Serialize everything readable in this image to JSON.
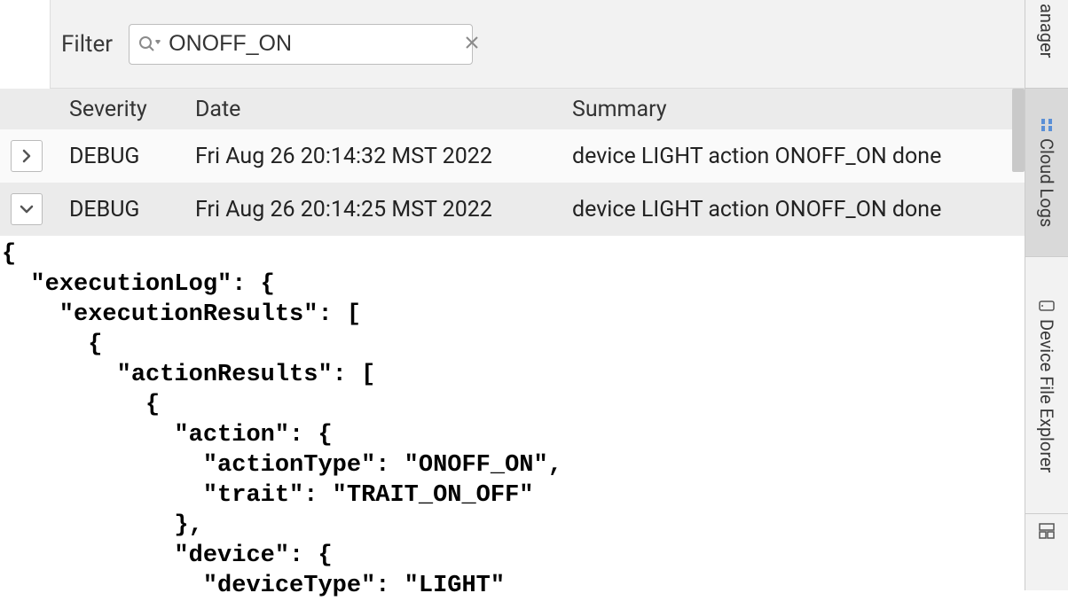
{
  "filter": {
    "label": "Filter",
    "value": "ONOFF_ON",
    "placeholder": ""
  },
  "columns": {
    "severity": "Severity",
    "date": "Date",
    "summary": "Summary"
  },
  "logs": [
    {
      "expanded": false,
      "severity": "DEBUG",
      "date": "Fri Aug 26 20:14:32 MST 2022",
      "summary": "device LIGHT action ONOFF_ON done"
    },
    {
      "expanded": true,
      "severity": "DEBUG",
      "date": "Fri Aug 26 20:14:25 MST 2022",
      "summary": "device LIGHT action ONOFF_ON done"
    }
  ],
  "expanded_json_lines": [
    "{",
    "  \"executionLog\": {",
    "    \"executionResults\": [",
    "      {",
    "        \"actionResults\": [",
    "          {",
    "            \"action\": {",
    "              \"actionType\": \"ONOFF_ON\",",
    "              \"trait\": \"TRAIT_ON_OFF\"",
    "            },",
    "            \"device\": {",
    "              \"deviceType\": \"LIGHT\""
  ],
  "sidebar": {
    "tab0_partial": "anager",
    "tab1": "Cloud Logs",
    "tab2": "Device File Explorer"
  }
}
